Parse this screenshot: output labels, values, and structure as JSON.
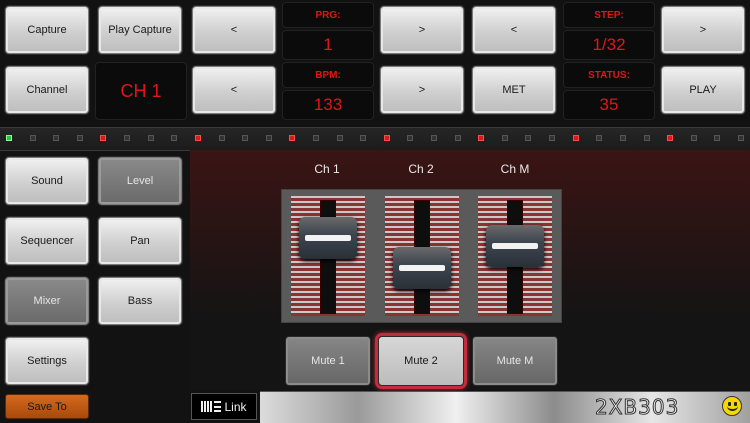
{
  "transport": {
    "capture": "Capture",
    "play_capture": "Play Capture",
    "prev": "<",
    "next": ">",
    "prg_label": "PRG:",
    "prg_value": "1",
    "step_label": "STEP:",
    "step_value": "1/32",
    "channel": "Channel",
    "channel_display": "CH 1",
    "bpm_label": "BPM:",
    "bpm_value": "133",
    "met": "MET",
    "status_label": "STATUS:",
    "status_value": "35",
    "play": "PLAY"
  },
  "nav": {
    "sound": "Sound",
    "level": "Level",
    "sequencer": "Sequencer",
    "pan": "Pan",
    "mixer": "Mixer",
    "bass": "Bass",
    "settings": "Settings",
    "save_to": "Save To"
  },
  "mixer": {
    "channels": [
      {
        "label": "Ch 1",
        "mute": "Mute 1",
        "muted": false,
        "level": 0.82
      },
      {
        "label": "Ch 2",
        "mute": "Mute 2",
        "muted": true,
        "level": 0.45
      },
      {
        "label": "Ch M",
        "mute": "Mute M",
        "muted": false,
        "level": 0.72
      }
    ]
  },
  "footer": {
    "link_label": "Link",
    "brand": "2XB303"
  },
  "colors": {
    "lcd_text": "#e01616",
    "mute_active_border": "#c22d3e",
    "save_button": "#c35a14"
  },
  "step_leds": [
    "green",
    "off",
    "off",
    "off",
    "red",
    "off",
    "off",
    "off",
    "red",
    "off",
    "off",
    "off",
    "red",
    "off",
    "off",
    "off",
    "red",
    "off",
    "off",
    "off",
    "red",
    "off",
    "off",
    "off",
    "red",
    "off",
    "off",
    "off",
    "red",
    "off",
    "off",
    "off"
  ]
}
